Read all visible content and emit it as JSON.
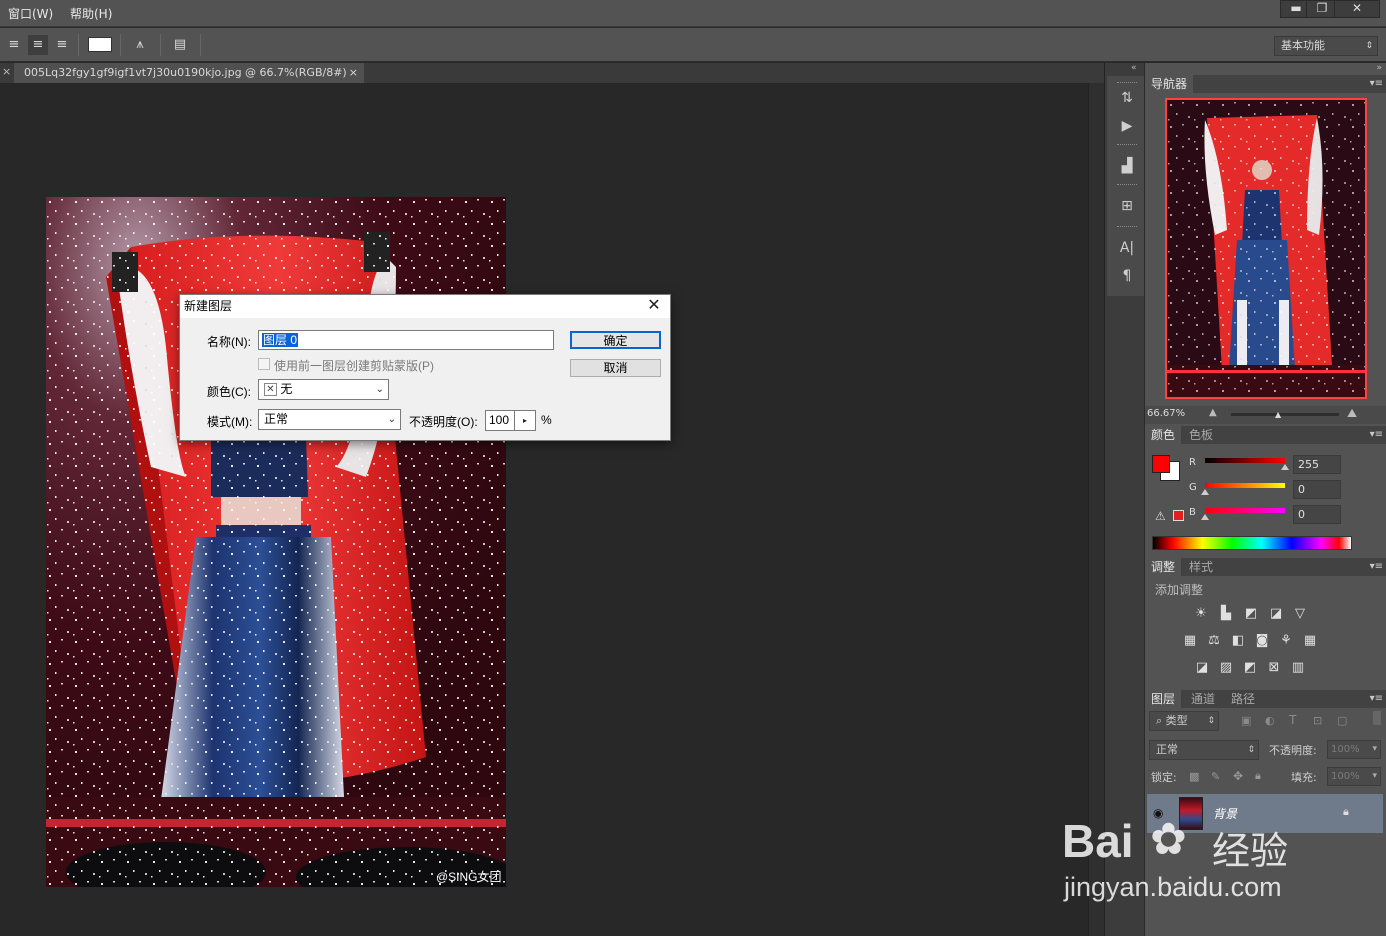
{
  "menubar": {
    "items": [
      "窗口(W)",
      "帮助(H)"
    ],
    "window_buttons": {
      "minimize": "▬",
      "restore": "❐",
      "close": "✕"
    }
  },
  "options": {
    "workspace": "基本功能"
  },
  "document": {
    "tab_title": "005Lq32fgy1gf9igf1vt7j30u0190kjo.jpg @ 66.7%(RGB/8#)",
    "tab_close": "×",
    "photo_credit": "@SING女团"
  },
  "dialog": {
    "title": "新建图层",
    "close": "✕",
    "name_label": "名称(N):",
    "name_value": "图层 0",
    "clip_label": "使用前一图层创建剪贴蒙版(P)",
    "color_label": "颜色(C):",
    "color_value": "无",
    "mode_label": "模式(M):",
    "mode_value": "正常",
    "opacity_label": "不透明度(O):",
    "opacity_value": "100",
    "opacity_unit": "%",
    "ok_label": "确定",
    "cancel_label": "取消"
  },
  "navigator": {
    "tab": "导航器",
    "zoom": "66.67%"
  },
  "color_panel": {
    "tabs": [
      "颜色",
      "色板"
    ],
    "foreground": "#ff0000",
    "r_label": "R",
    "r_value": "255",
    "g_label": "G",
    "g_value": "0",
    "b_label": "B",
    "b_value": "0"
  },
  "adjustments": {
    "tabs": [
      "调整",
      "样式"
    ],
    "heading": "添加调整"
  },
  "layers_panel": {
    "tabs": [
      "图层",
      "通道",
      "路径"
    ],
    "filter": "类型",
    "blend_mode": "正常",
    "opacity_label": "不透明度:",
    "opacity_value": "100%",
    "lock_label": "锁定:",
    "fill_label": "填充:",
    "fill_value": "100%",
    "layer_name": "背景"
  },
  "watermark": {
    "brand": "Bai",
    "brand_tail": "经验",
    "url": "jingyan.baidu.com"
  }
}
